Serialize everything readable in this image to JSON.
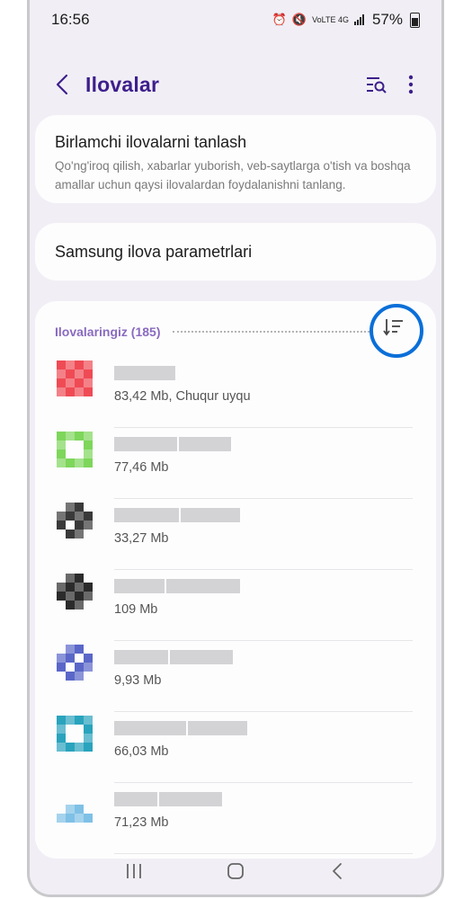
{
  "status_bar": {
    "time": "16:56",
    "signal_text": "VoLTE 4G",
    "battery": "57%"
  },
  "header": {
    "title": "Ilovalar",
    "icons": [
      "back-icon",
      "search-list-icon",
      "more-icon"
    ]
  },
  "default_apps_card": {
    "title": "Birlamchi ilovalarni tanlash",
    "description": "Qo'ng'iroq qilish, xabarlar yuborish, veb-saytlarga o'tish va boshqa amallar uchun qaysi ilovalardan foydalanishni tanlang."
  },
  "samsung_card": {
    "title": "Samsung ilova parametrlari"
  },
  "apps_section": {
    "header": "Ilovalaringiz (185)",
    "sort_icon": "sort-icon",
    "apps": [
      {
        "size": "83,42 Mb, Chuqur uyqu",
        "color": "#ef4b55"
      },
      {
        "size": "77,46 Mb",
        "color": "#7ed65b"
      },
      {
        "size": "33,27 Mb",
        "color": "#3a3a3a"
      },
      {
        "size": "109 Mb",
        "color": "#2b2b2b"
      },
      {
        "size": "9,93 Mb",
        "color": "#5a67c8"
      },
      {
        "size": "66,03 Mb",
        "color": "#2aa3bd"
      },
      {
        "size": "71,23 Mb",
        "color": "#7fc0e6"
      }
    ]
  },
  "navbar": {
    "icons": [
      "recents-icon",
      "home-icon",
      "back-nav-icon"
    ]
  },
  "colors": {
    "accent": "#3e1f8c",
    "section_header": "#8a6bbf",
    "highlight": "#0a6fd8"
  }
}
